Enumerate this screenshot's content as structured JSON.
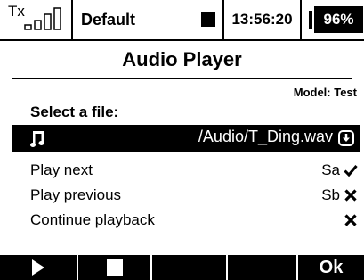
{
  "statusbar": {
    "tx_label": "Tx",
    "tx_signal_bars": 4,
    "model_name": "Default",
    "recording_icon": "stop-square-icon",
    "clock": "13:56:20",
    "battery_percent": "96%",
    "battery_level": 0.96
  },
  "page": {
    "title": "Audio Player",
    "model_tag": "Model: Test"
  },
  "file_select": {
    "label": "Select a file:",
    "icon": "music-note-icon",
    "path": "/Audio/T_Ding.wav",
    "action_icon": "download-arrow-icon"
  },
  "options": [
    {
      "label": "Play next",
      "switch": "Sa",
      "state_icon": "check-icon"
    },
    {
      "label": "Play previous",
      "switch": "Sb",
      "state_icon": "cross-icon"
    },
    {
      "label": "Continue playback",
      "switch": "",
      "state_icon": "cross-icon"
    }
  ],
  "function_keys": [
    {
      "icon": "play-icon",
      "label": ""
    },
    {
      "icon": "stop-icon",
      "label": ""
    },
    {
      "icon": "",
      "label": ""
    },
    {
      "icon": "",
      "label": ""
    },
    {
      "icon": "",
      "label": "Ok"
    }
  ],
  "colors": {
    "background": "#ffffff",
    "foreground": "#000000",
    "inverse_text": "#ffffff"
  }
}
